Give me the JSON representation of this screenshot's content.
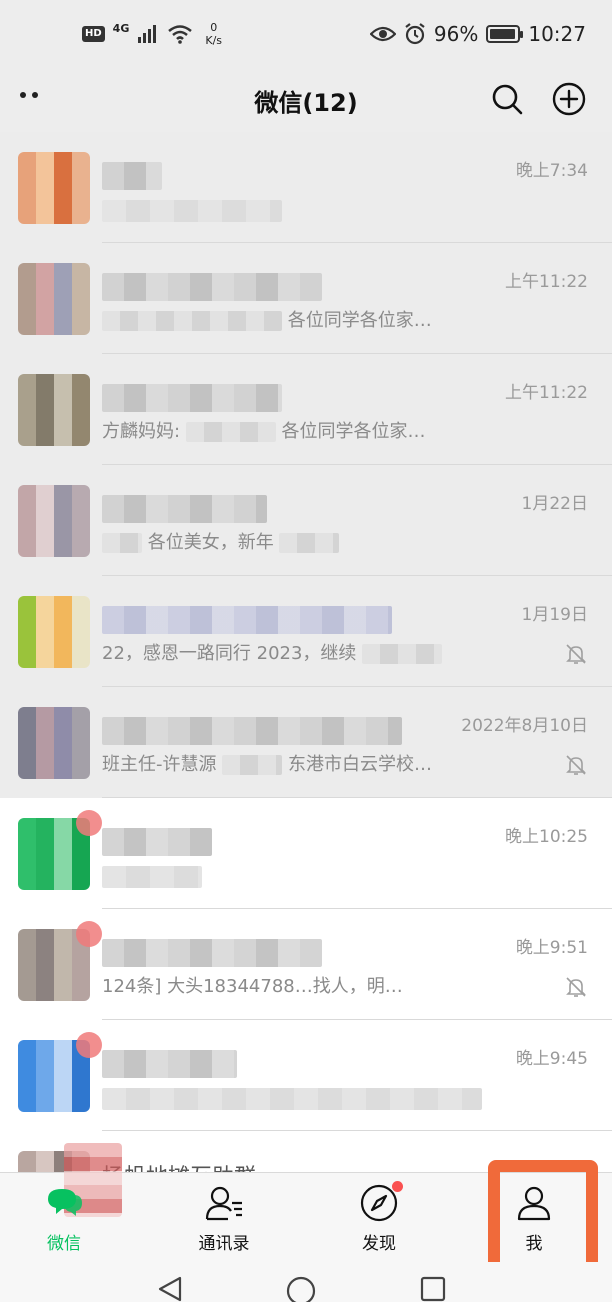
{
  "status_bar": {
    "hd": "HD",
    "network": "4G",
    "speed_value": "0",
    "speed_unit": "K/s",
    "battery": "96%",
    "time": "10:27"
  },
  "header": {
    "title": "微信(12)"
  },
  "chats": [
    {
      "time": "晚上7:34",
      "preview": "",
      "muted": false
    },
    {
      "time": "上午11:22",
      "preview": "各位同学各位家…",
      "muted": false
    },
    {
      "time": "上午11:22",
      "preview": "各位同学各位家…",
      "preview_prefix": "方麟妈妈:",
      "muted": false
    },
    {
      "time": "1月22日",
      "preview": "各位美女，新年",
      "muted": false
    },
    {
      "time": "1月19日",
      "preview": "22，感恩一路同行 2023，继续",
      "muted": true
    },
    {
      "time": "2022年8月10日",
      "preview": "东港市白云学校…",
      "preview_prefix": "班主任-许慧源",
      "muted": true
    },
    {
      "time": "晚上10:25",
      "preview": "",
      "muted": false
    },
    {
      "time": "晚上9:51",
      "preview": "124条] 大头18344788…找人，明…",
      "muted": true
    },
    {
      "time": "晚上9:45",
      "preview": "",
      "muted": false
    },
    {
      "time": "",
      "preview": "",
      "name_partial": "扬帆地摊互助群",
      "muted": false
    }
  ],
  "tabs": [
    {
      "label": "微信",
      "icon": "chat-icon",
      "active": true
    },
    {
      "label": "通讯录",
      "icon": "contacts-icon",
      "active": false
    },
    {
      "label": "发现",
      "icon": "compass-icon",
      "active": false,
      "has_dot": true
    },
    {
      "label": "我",
      "icon": "person-icon",
      "active": false
    }
  ],
  "colors": {
    "accent": "#07c160",
    "highlight": "#f06a3a",
    "badge": "#fa5151"
  }
}
